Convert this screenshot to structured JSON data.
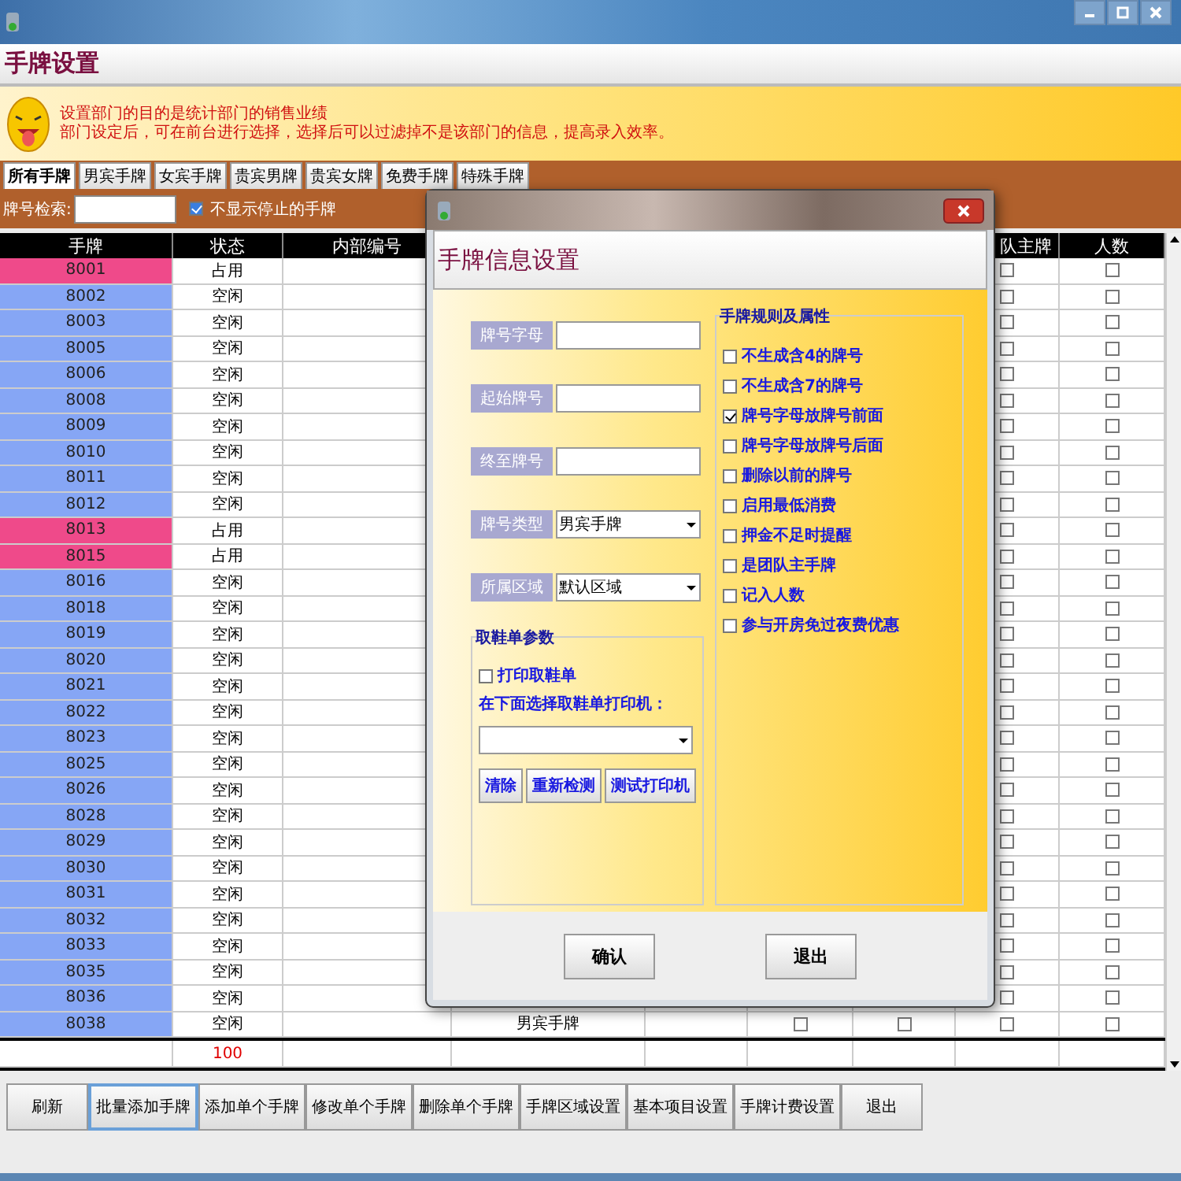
{
  "header": {
    "title": "手牌设置"
  },
  "banner": {
    "lines": [
      "设置部门的目的是统计部门的销售业绩",
      "部门设定后，可在前台进行选择，选择后可以过滤掉不是该部门的信息，提高录入效率。"
    ]
  },
  "tabs": [
    {
      "label": "所有手牌",
      "selected": true
    },
    {
      "label": "男宾手牌",
      "selected": false
    },
    {
      "label": "女宾手牌",
      "selected": false
    },
    {
      "label": "贵宾男牌",
      "selected": false
    },
    {
      "label": "贵宾女牌",
      "selected": false
    },
    {
      "label": "免费手牌",
      "selected": false
    },
    {
      "label": "特殊手牌",
      "selected": false
    }
  ],
  "search": {
    "label": "牌号检索:",
    "hide_stopped": {
      "label": "不显示停止的手牌",
      "checked": true
    }
  },
  "table": {
    "columns": [
      "手牌",
      "状态",
      "内部编号",
      "队主牌",
      "人数"
    ],
    "rows": [
      {
        "tag": "8001",
        "status": "占用",
        "occupied": true,
        "checks": [
          false,
          false
        ]
      },
      {
        "tag": "8002",
        "status": "空闲",
        "occupied": false,
        "checks": [
          false,
          false
        ]
      },
      {
        "tag": "8003",
        "status": "空闲",
        "occupied": false,
        "checks": [
          false,
          false
        ]
      },
      {
        "tag": "8005",
        "status": "空闲",
        "occupied": false,
        "checks": [
          false,
          false
        ]
      },
      {
        "tag": "8006",
        "status": "空闲",
        "occupied": false,
        "checks": [
          false,
          false
        ]
      },
      {
        "tag": "8008",
        "status": "空闲",
        "occupied": false,
        "checks": [
          false,
          false
        ]
      },
      {
        "tag": "8009",
        "status": "空闲",
        "occupied": false,
        "checks": [
          false,
          false
        ]
      },
      {
        "tag": "8010",
        "status": "空闲",
        "occupied": false,
        "checks": [
          false,
          false
        ]
      },
      {
        "tag": "8011",
        "status": "空闲",
        "occupied": false,
        "checks": [
          false,
          false
        ]
      },
      {
        "tag": "8012",
        "status": "空闲",
        "occupied": false,
        "checks": [
          false,
          false
        ]
      },
      {
        "tag": "8013",
        "status": "占用",
        "occupied": true,
        "checks": [
          false,
          false
        ]
      },
      {
        "tag": "8015",
        "status": "占用",
        "occupied": true,
        "checks": [
          false,
          false
        ]
      },
      {
        "tag": "8016",
        "status": "空闲",
        "occupied": false,
        "checks": [
          false,
          false
        ]
      },
      {
        "tag": "8018",
        "status": "空闲",
        "occupied": false,
        "checks": [
          false,
          false
        ]
      },
      {
        "tag": "8019",
        "status": "空闲",
        "occupied": false,
        "checks": [
          false,
          false
        ]
      },
      {
        "tag": "8020",
        "status": "空闲",
        "occupied": false,
        "checks": [
          false,
          false
        ]
      },
      {
        "tag": "8021",
        "status": "空闲",
        "occupied": false,
        "checks": [
          false,
          false
        ]
      },
      {
        "tag": "8022",
        "status": "空闲",
        "occupied": false,
        "checks": [
          false,
          false
        ]
      },
      {
        "tag": "8023",
        "status": "空闲",
        "occupied": false,
        "checks": [
          false,
          false
        ]
      },
      {
        "tag": "8025",
        "status": "空闲",
        "occupied": false,
        "checks": [
          false,
          false
        ]
      },
      {
        "tag": "8026",
        "status": "空闲",
        "occupied": false,
        "checks": [
          false,
          false
        ]
      },
      {
        "tag": "8028",
        "status": "空闲",
        "occupied": false,
        "checks": [
          false,
          false
        ]
      },
      {
        "tag": "8029",
        "status": "空闲",
        "occupied": false,
        "checks": [
          false,
          false
        ]
      },
      {
        "tag": "8030",
        "status": "空闲",
        "occupied": false,
        "checks": [
          false,
          false
        ]
      },
      {
        "tag": "8031",
        "status": "空闲",
        "occupied": false,
        "checks": [
          false,
          false
        ]
      },
      {
        "tag": "8032",
        "status": "空闲",
        "occupied": false,
        "checks": [
          false,
          false
        ]
      },
      {
        "tag": "8033",
        "status": "空闲",
        "occupied": false,
        "checks": [
          false,
          false
        ]
      },
      {
        "tag": "8035",
        "status": "空闲",
        "occupied": false,
        "checks": [
          false,
          false
        ]
      },
      {
        "tag": "8036",
        "status": "空闲",
        "occupied": false,
        "checks": [
          false,
          false
        ]
      },
      {
        "tag": "8038",
        "status": "空闲",
        "occupied": false,
        "type": "男宾手牌",
        "checks": [
          false,
          false,
          false,
          false
        ]
      }
    ],
    "total": "100"
  },
  "buttons": [
    {
      "label": "刷新",
      "focused": false
    },
    {
      "label": "批量添加手牌",
      "focused": true
    },
    {
      "label": "添加单个手牌",
      "focused": false
    },
    {
      "label": "修改单个手牌",
      "focused": false
    },
    {
      "label": "删除单个手牌",
      "focused": false
    },
    {
      "label": "手牌区域设置",
      "focused": false
    },
    {
      "label": "基本项目设置",
      "focused": false
    },
    {
      "label": "手牌计费设置",
      "focused": false
    },
    {
      "label": "退出",
      "focused": false
    }
  ],
  "dialog": {
    "title": "手牌信息设置",
    "fields": [
      {
        "label": "牌号字母",
        "kind": "input"
      },
      {
        "label": "起始牌号",
        "kind": "input"
      },
      {
        "label": "终至牌号",
        "kind": "input"
      },
      {
        "label": "牌号类型",
        "kind": "select",
        "value": "男宾手牌"
      },
      {
        "label": "所属区域",
        "kind": "select",
        "value": "默认区域"
      }
    ],
    "shoe_slip": {
      "title": "取鞋单参数",
      "print": {
        "label": "打印取鞋单",
        "checked": false
      },
      "printer_label": "在下面选择取鞋单打印机：",
      "buttons": [
        "清除",
        "重新检测",
        "测试打印机"
      ]
    },
    "rules": {
      "title": "手牌规则及属性",
      "options": [
        {
          "label": "不生成含4的牌号",
          "checked": false
        },
        {
          "label": "不生成含7的牌号",
          "checked": false
        },
        {
          "label": "牌号字母放牌号前面",
          "checked": true
        },
        {
          "label": "牌号字母放牌号后面",
          "checked": false
        },
        {
          "label": "删除以前的牌号",
          "checked": false
        },
        {
          "label": "启用最低消费",
          "checked": false
        },
        {
          "label": "押金不足时提醒",
          "checked": false
        },
        {
          "label": "是团队主手牌",
          "checked": false
        },
        {
          "label": "记入人数",
          "checked": false
        },
        {
          "label": "参与开房免过夜费优惠",
          "checked": false
        }
      ]
    },
    "buttons": [
      "确认",
      "退出"
    ]
  }
}
